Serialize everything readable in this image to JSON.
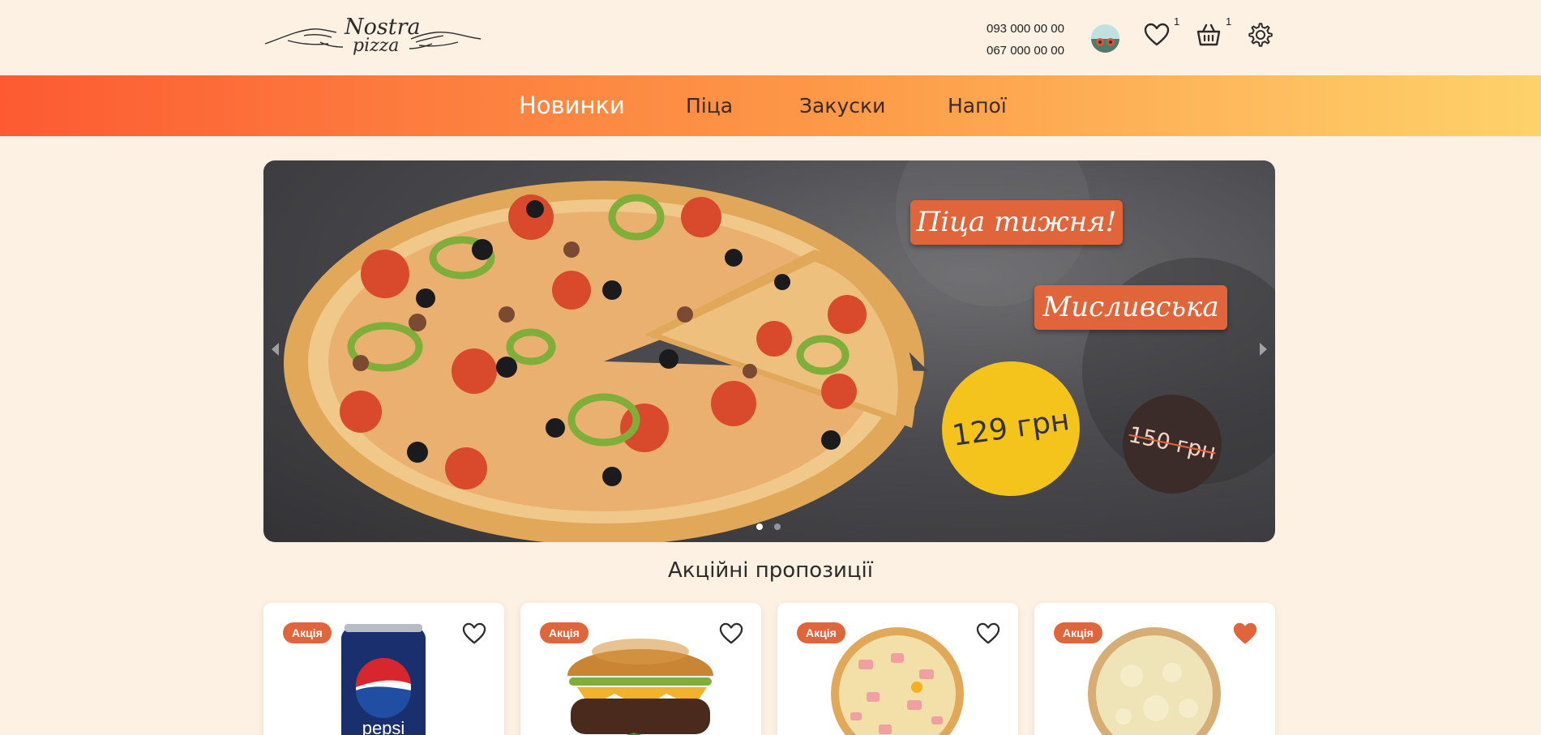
{
  "brand": {
    "line1": "Nostra",
    "line2": "pizza"
  },
  "contacts": {
    "phone1": "093 000 00 00",
    "phone2": "067 000 00 00"
  },
  "header_icons": {
    "favorites_count": "1",
    "cart_count": "1",
    "favorites_icon": "heart-icon",
    "cart_icon": "basket-icon",
    "settings_icon": "gear-icon"
  },
  "nav": {
    "items": [
      "Новинки",
      "Піца",
      "Закуски",
      "Напої"
    ],
    "active": "Новинки"
  },
  "banner": {
    "tag1": "Піца тижня!",
    "tag2": "Мисливська",
    "price_new": "129 грн",
    "price_old": "150 грн",
    "slides": 2,
    "active_slide": 1
  },
  "section": {
    "title": "Акційні пропозиції"
  },
  "products": [
    {
      "badge": "Акція",
      "favorited": false,
      "image": "pepsi-can"
    },
    {
      "badge": "Акція",
      "favorited": false,
      "image": "burger"
    },
    {
      "badge": "Акція",
      "favorited": false,
      "image": "ham-pizza"
    },
    {
      "badge": "Акція",
      "favorited": true,
      "image": "cheese-pizza"
    }
  ],
  "colors": {
    "accent": "#e0653a",
    "background": "#fdf1e3",
    "nav_start": "#fd5a32",
    "nav_end": "#fed26a",
    "price_yellow": "#f5c41c"
  }
}
